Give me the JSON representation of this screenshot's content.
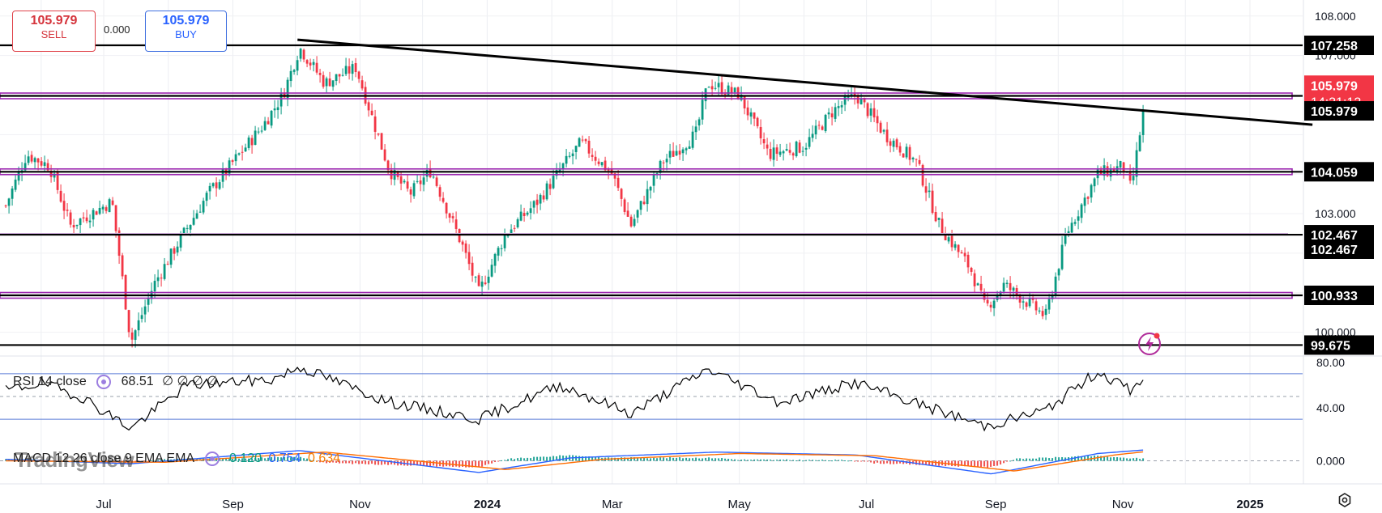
{
  "toolbar": {
    "sell_price": "105.979",
    "sell_label": "SELL",
    "buy_price": "105.979",
    "buy_label": "BUY",
    "spread": "0.000"
  },
  "indicators": {
    "rsi": {
      "name": "RSI 14 close",
      "value": "68.51",
      "extra": "∅ ∅ ∅ ∅"
    },
    "macd": {
      "name": "MACD 12 26 close 9 EMA EMA",
      "hist": "0.120",
      "macd": "0.754",
      "signal": "0.634"
    },
    "watermark": "TradingView"
  },
  "colors": {
    "up": "#089981",
    "down": "#f23645",
    "support": "#9c27b0",
    "rsi_line": "#000000",
    "macd_line": "#2962ff",
    "signal_line": "#ff6d00"
  },
  "chart_data": [
    {
      "type": "candlestick",
      "title": "",
      "x_tick_labels": [
        "Jul",
        "Sep",
        "Nov",
        "2024",
        "Mar",
        "May",
        "Jul",
        "Sep",
        "Nov",
        "2025"
      ],
      "y_tick_labels": [
        "108.000",
        "107.000",
        "103.000",
        "100.000"
      ],
      "ylim": [
        99.5,
        108.2
      ],
      "horizontal_levels": [
        {
          "label": "107.258",
          "value": 107.258,
          "style": "black"
        },
        {
          "label": "105.979",
          "value": 105.979,
          "style": "purple-band"
        },
        {
          "label": "104.059",
          "value": 104.059,
          "style": "purple-band"
        },
        {
          "label": "102.467",
          "value": 102.467,
          "style": "black"
        },
        {
          "label": "100.933",
          "value": 100.933,
          "style": "purple-band"
        },
        {
          "label": "99.675",
          "value": 99.675,
          "style": "black"
        }
      ],
      "current_price": {
        "value": "105.979",
        "countdown": "14:31:12",
        "label2": "105.979",
        "label3": "102.467"
      },
      "trendline": {
        "from": {
          "date": "2023-10-02",
          "value": 107.4
        },
        "to": {
          "date": "2025-01-31",
          "value": 105.25
        }
      },
      "price_path": [
        {
          "date": "2023-05-15",
          "value": 103.2
        },
        {
          "date": "2023-05-25",
          "value": 104.5
        },
        {
          "date": "2023-06-05",
          "value": 104.2
        },
        {
          "date": "2023-06-15",
          "value": 102.7
        },
        {
          "date": "2023-06-28",
          "value": 103.1
        },
        {
          "date": "2023-07-05",
          "value": 103.3
        },
        {
          "date": "2023-07-14",
          "value": 99.75
        },
        {
          "date": "2023-07-25",
          "value": 101.2
        },
        {
          "date": "2023-08-05",
          "value": 102.2
        },
        {
          "date": "2023-08-20",
          "value": 103.5
        },
        {
          "date": "2023-09-01",
          "value": 104.3
        },
        {
          "date": "2023-09-15",
          "value": 105.2
        },
        {
          "date": "2023-09-25",
          "value": 106.0
        },
        {
          "date": "2023-10-03",
          "value": 107.2
        },
        {
          "date": "2023-10-15",
          "value": 106.3
        },
        {
          "date": "2023-10-30",
          "value": 106.7
        },
        {
          "date": "2023-11-15",
          "value": 104.1
        },
        {
          "date": "2023-11-25",
          "value": 103.5
        },
        {
          "date": "2023-12-05",
          "value": 104.1
        },
        {
          "date": "2023-12-20",
          "value": 102.2
        },
        {
          "date": "2023-12-28",
          "value": 101.0
        },
        {
          "date": "2024-01-10",
          "value": 102.5
        },
        {
          "date": "2024-01-25",
          "value": 103.3
        },
        {
          "date": "2024-02-05",
          "value": 104.1
        },
        {
          "date": "2024-02-15",
          "value": 104.8
        },
        {
          "date": "2024-03-01",
          "value": 104.0
        },
        {
          "date": "2024-03-10",
          "value": 102.7
        },
        {
          "date": "2024-03-25",
          "value": 104.3
        },
        {
          "date": "2024-04-10",
          "value": 105.0
        },
        {
          "date": "2024-04-16",
          "value": 106.3
        },
        {
          "date": "2024-05-01",
          "value": 106.0
        },
        {
          "date": "2024-05-15",
          "value": 104.5
        },
        {
          "date": "2024-06-01",
          "value": 104.7
        },
        {
          "date": "2024-06-15",
          "value": 105.6
        },
        {
          "date": "2024-06-26",
          "value": 106.0
        },
        {
          "date": "2024-07-10",
          "value": 105.0
        },
        {
          "date": "2024-07-25",
          "value": 104.3
        },
        {
          "date": "2024-08-05",
          "value": 102.7
        },
        {
          "date": "2024-08-20",
          "value": 101.6
        },
        {
          "date": "2024-08-27",
          "value": 100.6
        },
        {
          "date": "2024-09-05",
          "value": 101.2
        },
        {
          "date": "2024-09-25",
          "value": 100.4
        },
        {
          "date": "2024-10-05",
          "value": 102.5
        },
        {
          "date": "2024-10-20",
          "value": 104.0
        },
        {
          "date": "2024-11-01",
          "value": 104.2
        },
        {
          "date": "2024-11-05",
          "value": 103.6
        },
        {
          "date": "2024-11-12",
          "value": 105.979
        }
      ],
      "rsi": {
        "levels": [
          "80.00",
          "40.00"
        ],
        "upper": 70,
        "lower": 30,
        "path": [
          {
            "date": "2023-05-15",
            "value": 55
          },
          {
            "date": "2023-06-01",
            "value": 62
          },
          {
            "date": "2023-06-20",
            "value": 50
          },
          {
            "date": "2023-07-14",
            "value": 22
          },
          {
            "date": "2023-08-10",
            "value": 60
          },
          {
            "date": "2023-09-20",
            "value": 65
          },
          {
            "date": "2023-10-03",
            "value": 76
          },
          {
            "date": "2023-11-15",
            "value": 45
          },
          {
            "date": "2023-12-28",
            "value": 30
          },
          {
            "date": "2024-02-05",
            "value": 60
          },
          {
            "date": "2024-03-10",
            "value": 35
          },
          {
            "date": "2024-04-16",
            "value": 74
          },
          {
            "date": "2024-05-20",
            "value": 45
          },
          {
            "date": "2024-06-26",
            "value": 62
          },
          {
            "date": "2024-07-25",
            "value": 44
          },
          {
            "date": "2024-08-27",
            "value": 24
          },
          {
            "date": "2024-09-25",
            "value": 38
          },
          {
            "date": "2024-10-20",
            "value": 72
          },
          {
            "date": "2024-11-05",
            "value": 55
          },
          {
            "date": "2024-11-12",
            "value": 68.51
          }
        ]
      },
      "macd": {
        "levels": [
          "0.000"
        ],
        "macd": [
          {
            "date": "2023-05-15",
            "value": 0.1
          },
          {
            "date": "2023-07-14",
            "value": -0.2
          },
          {
            "date": "2023-10-03",
            "value": 0.7
          },
          {
            "date": "2023-12-28",
            "value": -0.8
          },
          {
            "date": "2024-02-10",
            "value": 0.2
          },
          {
            "date": "2024-04-20",
            "value": 0.6
          },
          {
            "date": "2024-06-26",
            "value": 0.4
          },
          {
            "date": "2024-08-30",
            "value": -0.9
          },
          {
            "date": "2024-10-20",
            "value": 0.5
          },
          {
            "date": "2024-11-12",
            "value": 0.754
          }
        ],
        "signal": [
          {
            "date": "2023-05-15",
            "value": 0.0
          },
          {
            "date": "2023-07-30",
            "value": -0.1
          },
          {
            "date": "2023-10-15",
            "value": 0.6
          },
          {
            "date": "2024-01-10",
            "value": -0.6
          },
          {
            "date": "2024-02-25",
            "value": 0.1
          },
          {
            "date": "2024-05-01",
            "value": 0.5
          },
          {
            "date": "2024-07-05",
            "value": 0.35
          },
          {
            "date": "2024-09-10",
            "value": -0.7
          },
          {
            "date": "2024-10-28",
            "value": 0.4
          },
          {
            "date": "2024-11-12",
            "value": 0.634
          }
        ]
      }
    }
  ]
}
